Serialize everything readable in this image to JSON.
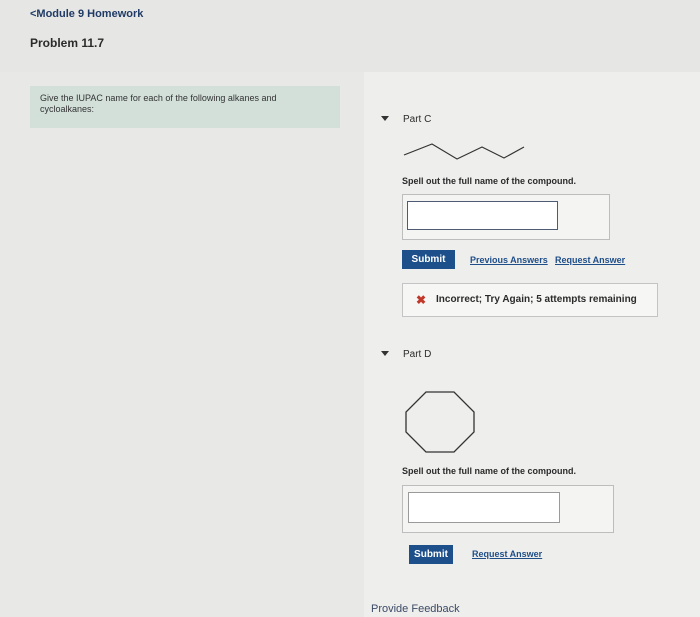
{
  "header": {
    "back_label": "<Module 9 Homework",
    "problem_title": "Problem 11.7"
  },
  "intro": {
    "text": "Give the IUPAC name for each of the following alkanes and cycloalkanes:"
  },
  "part_c": {
    "title": "Part C",
    "prompt": "Spell out the full name of the compound.",
    "input_value": "",
    "submit_label": "Submit",
    "previous_answers_label": "Previous Answers",
    "request_answer_label": "Request Answer",
    "feedback_text": "Incorrect; Try Again; 5 attempts remaining",
    "structure": "zigzag-chain"
  },
  "part_d": {
    "title": "Part D",
    "prompt": "Spell out the full name of the compound.",
    "input_value": "",
    "submit_label": "Submit",
    "request_answer_label": "Request Answer",
    "structure": "cyclooctane-octagon"
  },
  "footer": {
    "provide_feedback_label": "Provide Feedback"
  },
  "colors": {
    "accent": "#1d4f8a",
    "link": "#1f4e88",
    "error": "#c0392b",
    "intro_bg": "#d3e0da"
  }
}
